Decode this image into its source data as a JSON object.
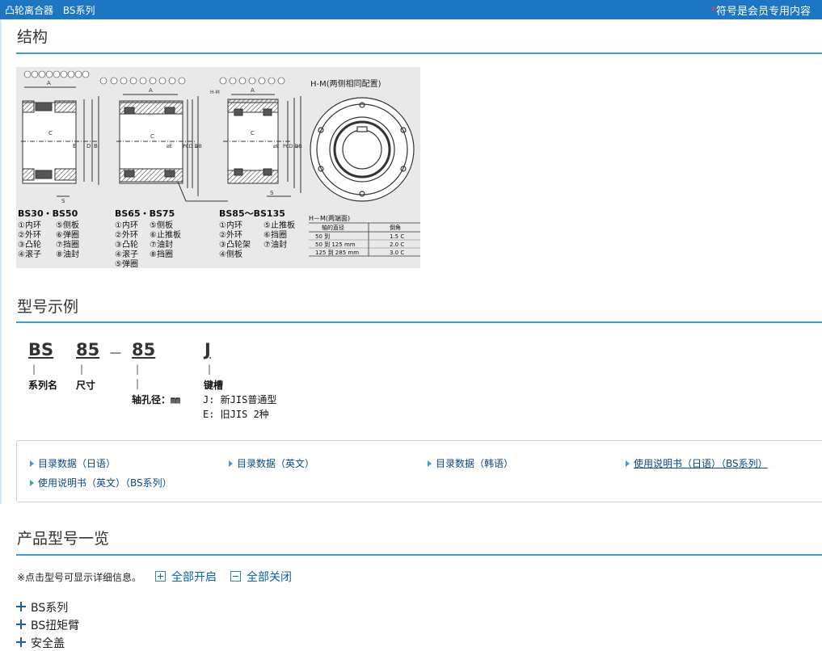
{
  "header": {
    "breadcrumb": [
      "凸轮离合器",
      "BS系列"
    ],
    "member_note_star": "*",
    "member_note": "符号是会员专用内容"
  },
  "sections": {
    "structure": "结构",
    "model_example": "型号示例",
    "product_list": "产品型号一览"
  },
  "diagram": {
    "group1_title": "BS30・BS50",
    "group1_parts": [
      "①内环",
      "⑤侧板",
      "②外环",
      "⑥弹圈",
      "③凸轮",
      "⑦挡圈",
      "④滚子",
      "⑧油封"
    ],
    "group2_title": "BS65・BS75",
    "group2_parts": [
      "①内环",
      "⑤侧板",
      "②外环",
      "⑥止推板",
      "③凸轮",
      "⑦油封",
      "④滚子",
      "⑧挡圈",
      "⑤弹圈"
    ],
    "group3_title": "BS85～BS135",
    "group3_parts": [
      "①内环",
      "⑤止推板",
      "②外环",
      "⑥挡圈",
      "③凸轮架",
      "⑦油封",
      "④侧板"
    ],
    "hm_title": "H-M(两侧相同配置)",
    "hm_table_title": "H－M(两端面)",
    "hm_table_headers": [
      "轴的直径",
      "倒角"
    ],
    "hm_table_rows": [
      [
        "50 到",
        "1.5 C"
      ],
      [
        "50 到 125 mm",
        "2.0 C"
      ],
      [
        "125 到 285 mm",
        "3.0 C"
      ]
    ],
    "labels": {
      "A": "A",
      "C": "C",
      "E": "E",
      "D": "D",
      "B": "B",
      "S": "S",
      "HM": "H-M",
      "PCD": "PCD D",
      "phiE": "øE",
      "phiB": "øB"
    }
  },
  "model": {
    "series_code": "BS",
    "size_code": "85",
    "dash": "－",
    "bore_code": "85",
    "key_code": "J",
    "tick": "|",
    "series_label": "系列名",
    "size_label": "尺寸",
    "bore_label": "轴孔径：㎜",
    "key_label": "键槽",
    "key_option_j": "J: 新JIS普通型",
    "key_option_e": "E: 旧JIS 2种"
  },
  "links": [
    {
      "label": "目录数据（日语）"
    },
    {
      "label": "目录数据（英文）"
    },
    {
      "label": "目录数据（韩语）"
    },
    {
      "label": "使用说明书（日语）（BS系列）"
    },
    {
      "label": "使用说明书（英文）（BS系列）"
    }
  ],
  "list": {
    "hint": "※点击型号可显示详细信息。",
    "open_all": "全部开启",
    "close_all": "全部关闭",
    "items": [
      "BS系列",
      "BS扭矩臂",
      "安全盖"
    ]
  },
  "colors": {
    "header_bg": "#1d76c3",
    "rule": "#3a9fd3",
    "link": "#0a4a86"
  }
}
